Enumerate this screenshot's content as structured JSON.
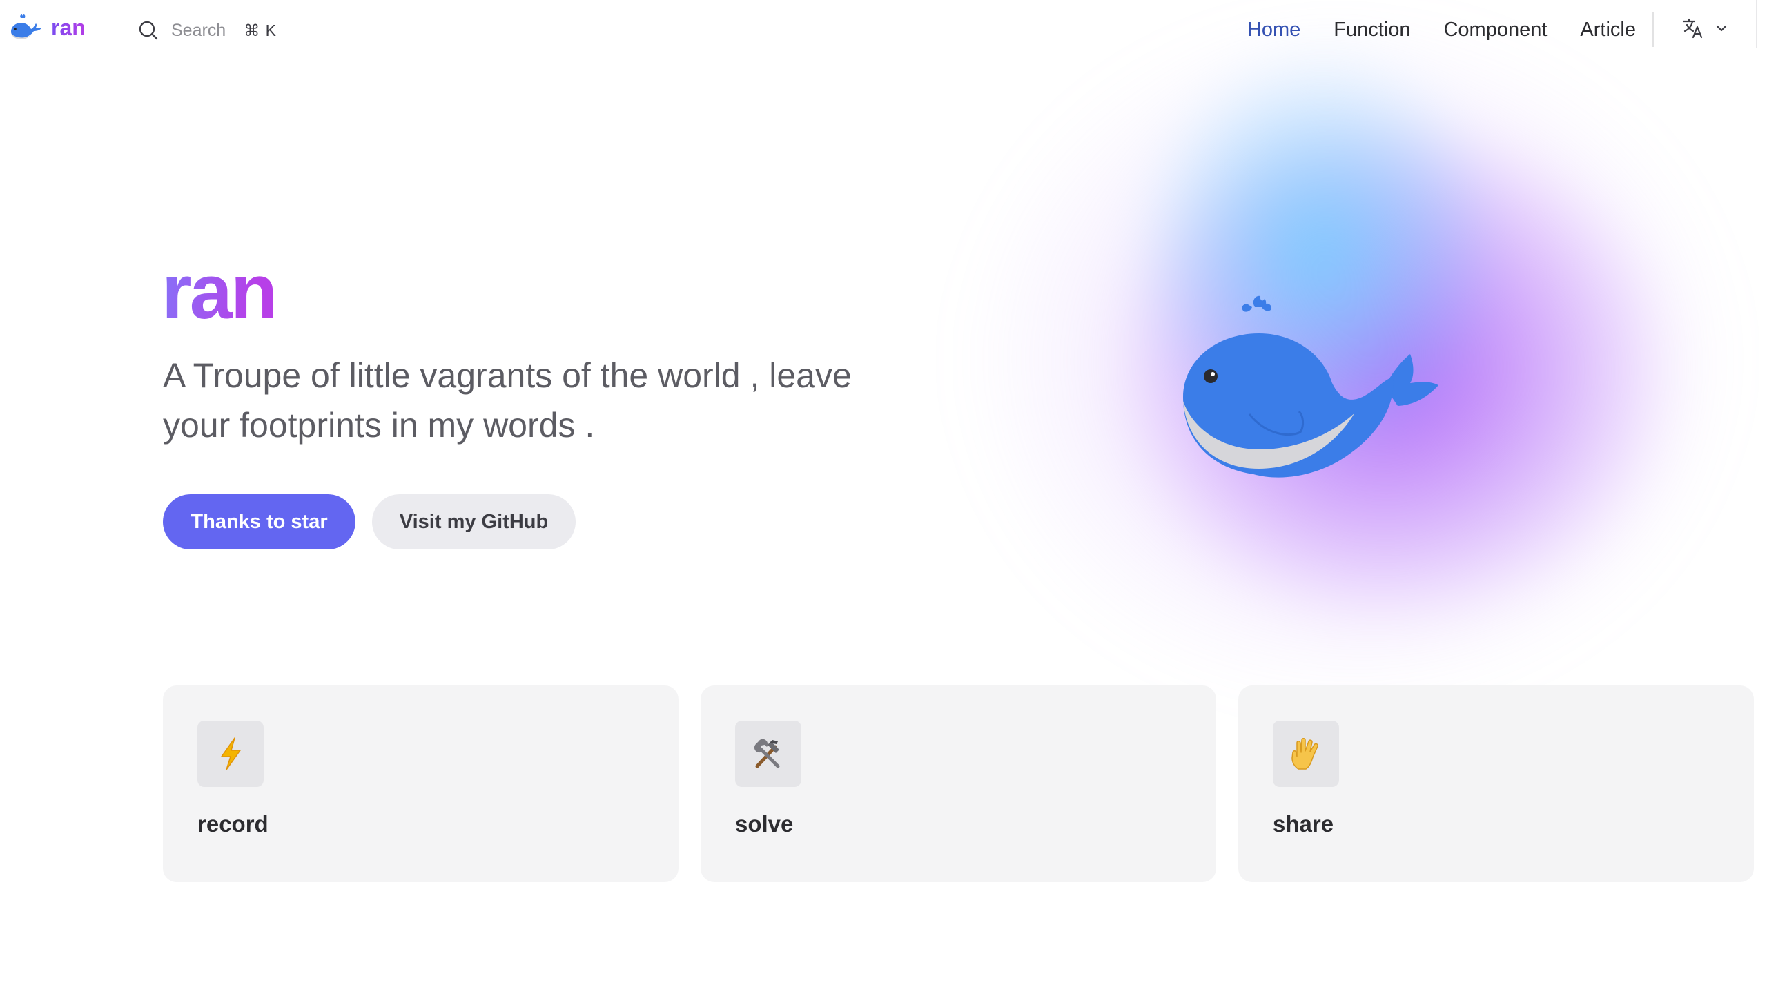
{
  "nav": {
    "brand": "ran",
    "search": {
      "label": "Search",
      "shortcut": "⌘ K"
    },
    "links": [
      "Home",
      "Function",
      "Component",
      "Article"
    ],
    "active_link": "Home",
    "language_icon": "translate-icon"
  },
  "hero": {
    "name": "ran",
    "tagline": "A Troupe of little vagrants of the world , leave your footprints in my words .",
    "primary_button": "Thanks to star",
    "secondary_button": "Visit my GitHub",
    "image": "whale-logo"
  },
  "features": [
    {
      "title": "record",
      "icon": "lightning-icon"
    },
    {
      "title": "solve",
      "icon": "hammer-wrench-icon"
    },
    {
      "title": "share",
      "icon": "vulcan-hand-icon"
    }
  ],
  "colors": {
    "brand": "#6366f1",
    "active_link": "#3451b2",
    "whale": "#3b7de8"
  }
}
